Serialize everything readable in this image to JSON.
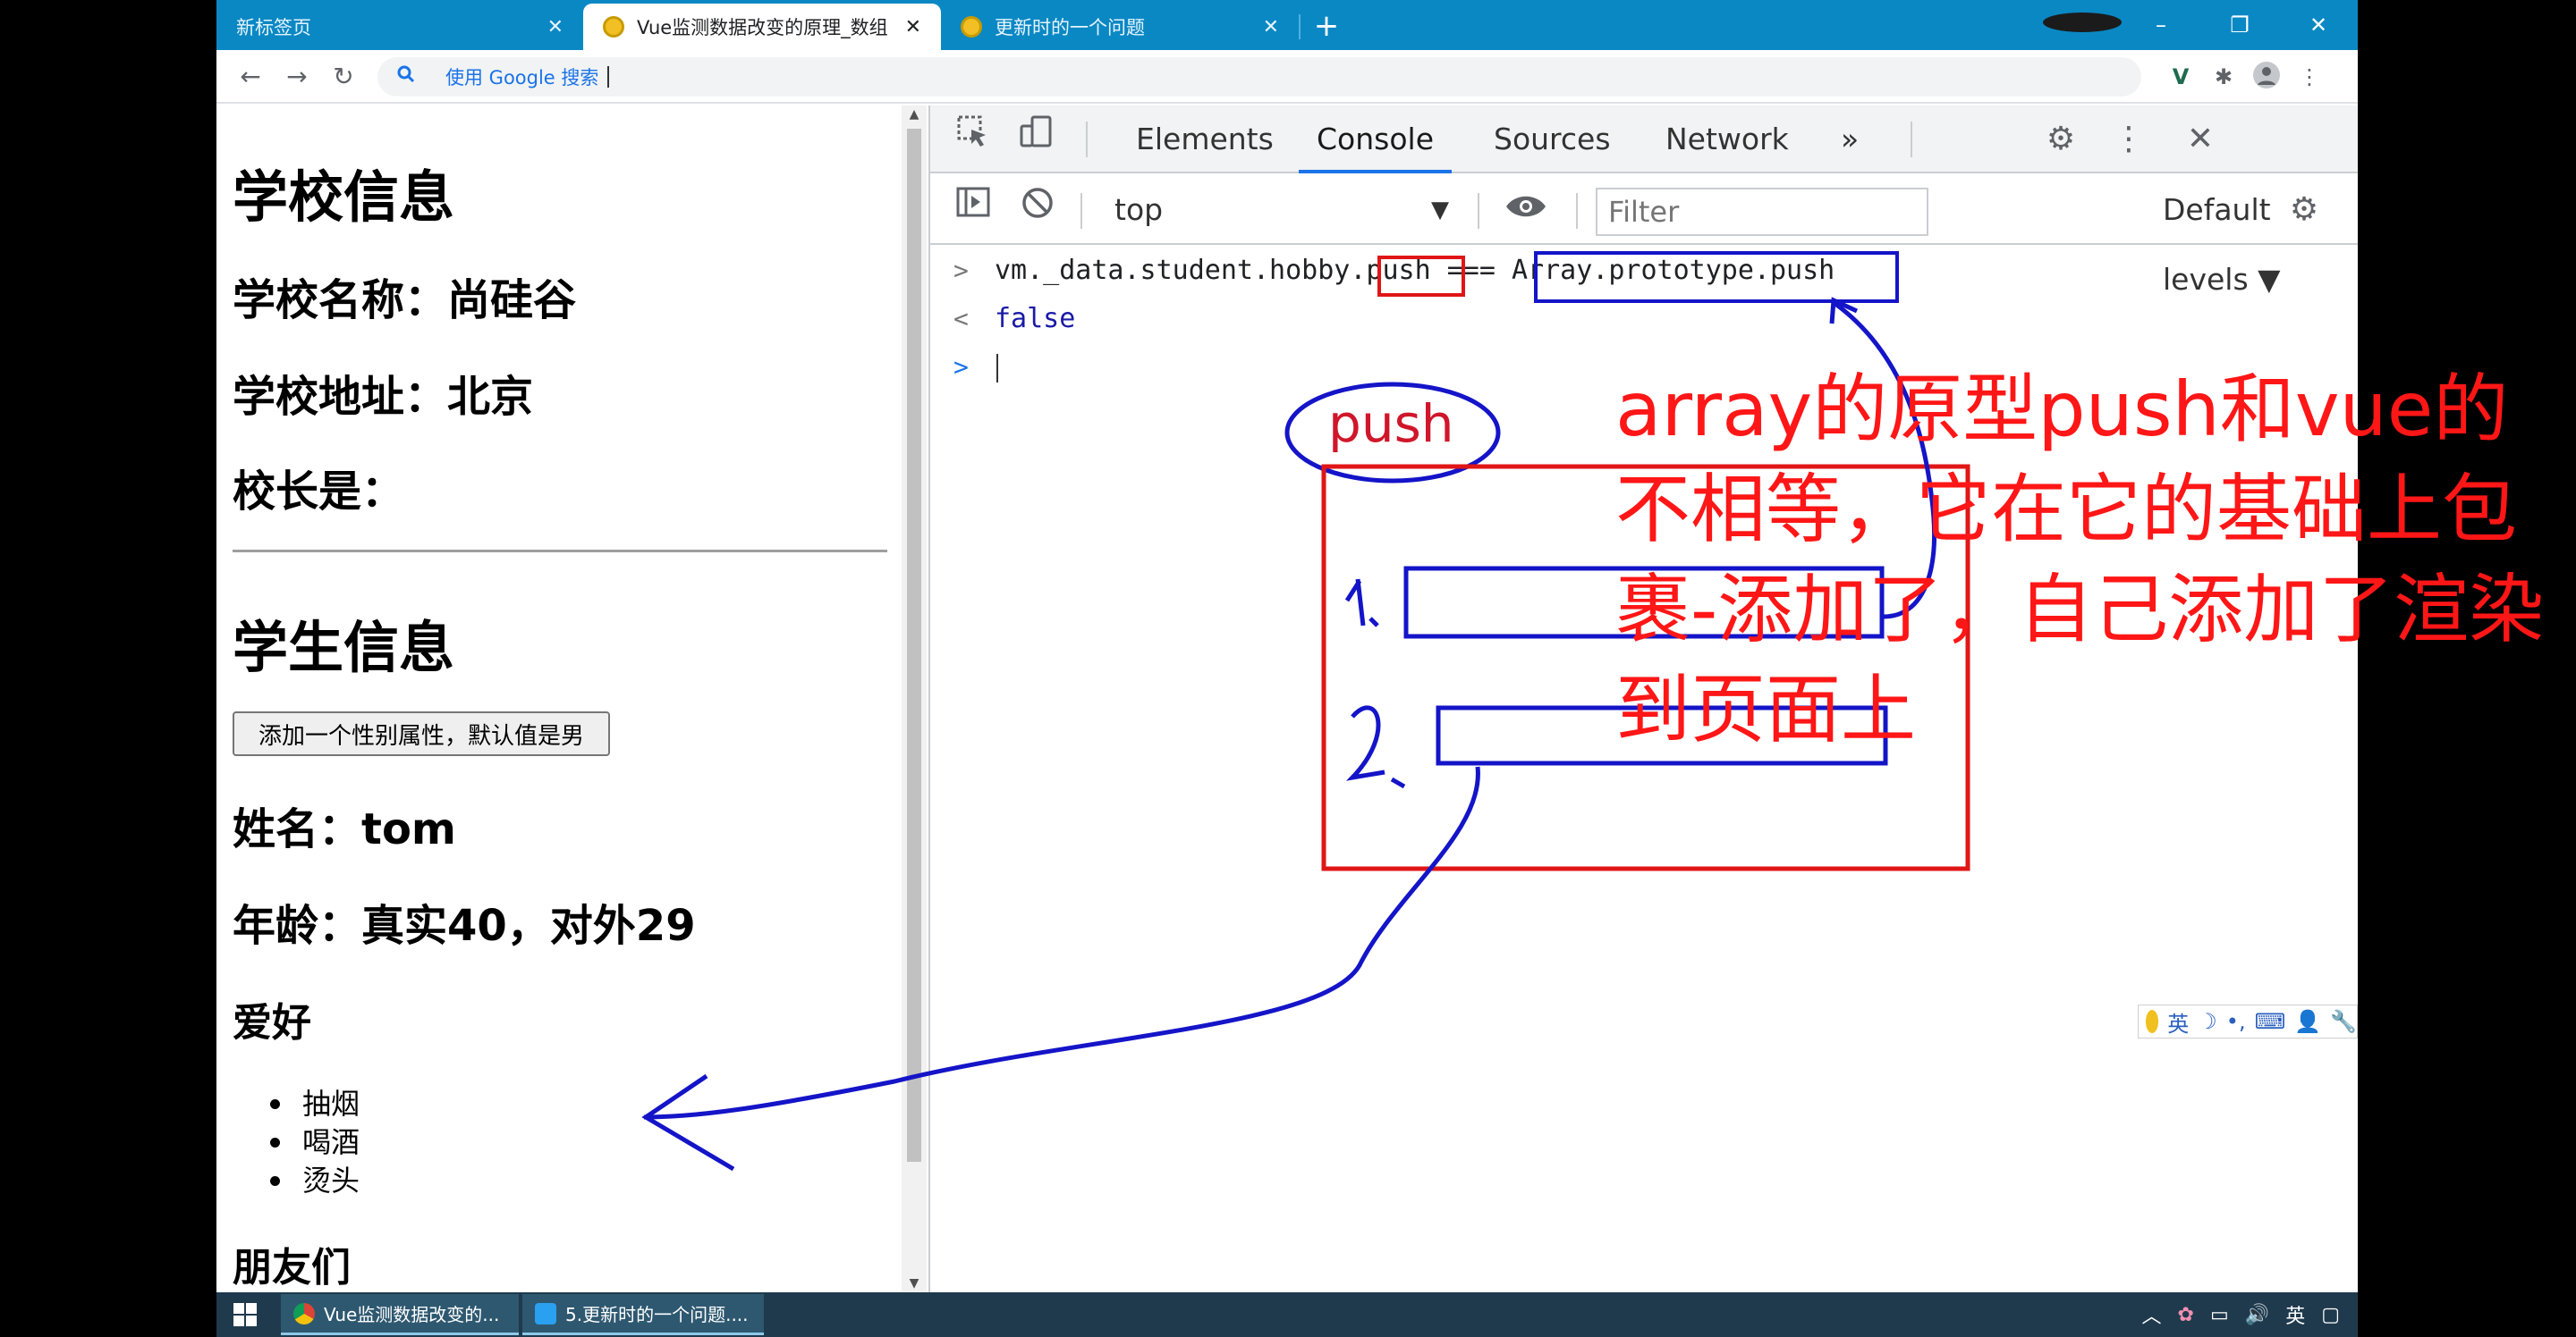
{
  "browser": {
    "tabs": [
      {
        "label": "新标签页",
        "close": "✕"
      },
      {
        "label": "Vue监测数据改变的原理_数组",
        "close": "✕"
      },
      {
        "label": "更新时的一个问题",
        "close": "✕"
      }
    ],
    "new_tab": "+",
    "window_controls": {
      "minimize": "–",
      "restore": "❐",
      "close": "✕"
    },
    "nav": {
      "back": "←",
      "forward": "→",
      "reload": "↻"
    },
    "omnibox_placeholder": "使用 Google 搜索"
  },
  "page": {
    "school_heading": "学校信息",
    "school_name": "学校名称：尚硅谷",
    "school_address": "学校地址：北京",
    "principal": "校长是：",
    "student_heading": "学生信息",
    "add_sex_button": "添加一个性别属性，默认值是男",
    "student_name": "姓名：tom",
    "student_age": "年龄：真实40，对外29",
    "hobby_heading": "爱好",
    "hobbies": [
      "抽烟",
      "喝酒",
      "烫头"
    ],
    "friends_heading": "朋友们"
  },
  "devtools": {
    "tabs": [
      "Elements",
      "Console",
      "Sources",
      "Network"
    ],
    "active_tab": "Console",
    "more_tabs": "»",
    "context": "top",
    "filter_placeholder": "Filter",
    "levels": "Default levels ▼",
    "console_lines": [
      {
        "prefix": ">",
        "text": "vm._data.student.hobby.push === Array.prototype.push"
      },
      {
        "prefix": "<",
        "text": "false"
      },
      {
        "prefix": ">",
        "text": ""
      }
    ]
  },
  "annotation": {
    "note": "array的原型push和vue的不相等，它在它的基础上包裹-添加了，自己添加了渲染到页面上",
    "push_label": "push",
    "step_1": "1.",
    "step_2": "2."
  },
  "ime": {
    "lang": "英"
  },
  "taskbar": {
    "tasks": [
      {
        "label": "Vue监测数据改变的..."
      },
      {
        "label": "5.更新时的一个问题...."
      }
    ],
    "tray_lang": "英"
  }
}
